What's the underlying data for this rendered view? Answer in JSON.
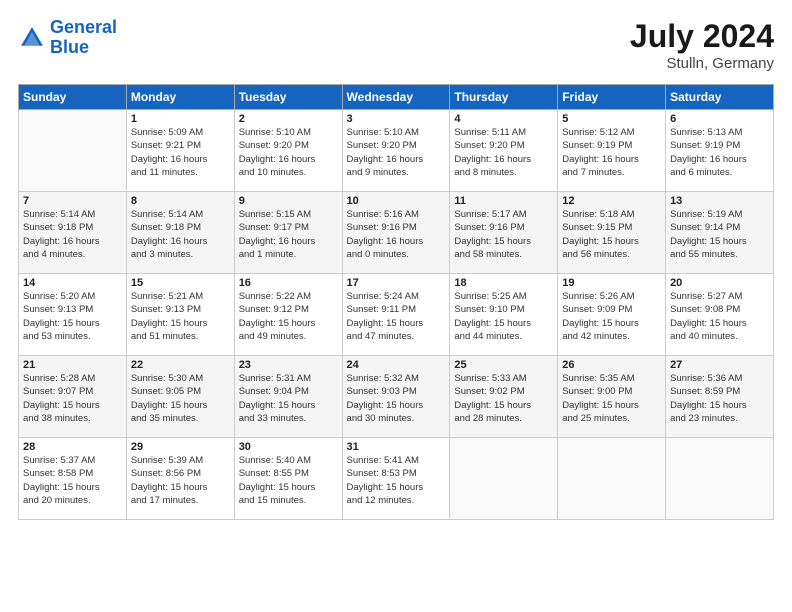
{
  "header": {
    "logo_line1": "General",
    "logo_line2": "Blue",
    "title": "July 2024",
    "location": "Stulln, Germany"
  },
  "columns": [
    "Sunday",
    "Monday",
    "Tuesday",
    "Wednesday",
    "Thursday",
    "Friday",
    "Saturday"
  ],
  "weeks": [
    [
      {
        "day": "",
        "info": ""
      },
      {
        "day": "1",
        "info": "Sunrise: 5:09 AM\nSunset: 9:21 PM\nDaylight: 16 hours\nand 11 minutes."
      },
      {
        "day": "2",
        "info": "Sunrise: 5:10 AM\nSunset: 9:20 PM\nDaylight: 16 hours\nand 10 minutes."
      },
      {
        "day": "3",
        "info": "Sunrise: 5:10 AM\nSunset: 9:20 PM\nDaylight: 16 hours\nand 9 minutes."
      },
      {
        "day": "4",
        "info": "Sunrise: 5:11 AM\nSunset: 9:20 PM\nDaylight: 16 hours\nand 8 minutes."
      },
      {
        "day": "5",
        "info": "Sunrise: 5:12 AM\nSunset: 9:19 PM\nDaylight: 16 hours\nand 7 minutes."
      },
      {
        "day": "6",
        "info": "Sunrise: 5:13 AM\nSunset: 9:19 PM\nDaylight: 16 hours\nand 6 minutes."
      }
    ],
    [
      {
        "day": "7",
        "info": "Sunrise: 5:14 AM\nSunset: 9:18 PM\nDaylight: 16 hours\nand 4 minutes."
      },
      {
        "day": "8",
        "info": "Sunrise: 5:14 AM\nSunset: 9:18 PM\nDaylight: 16 hours\nand 3 minutes."
      },
      {
        "day": "9",
        "info": "Sunrise: 5:15 AM\nSunset: 9:17 PM\nDaylight: 16 hours\nand 1 minute."
      },
      {
        "day": "10",
        "info": "Sunrise: 5:16 AM\nSunset: 9:16 PM\nDaylight: 16 hours\nand 0 minutes."
      },
      {
        "day": "11",
        "info": "Sunrise: 5:17 AM\nSunset: 9:16 PM\nDaylight: 15 hours\nand 58 minutes."
      },
      {
        "day": "12",
        "info": "Sunrise: 5:18 AM\nSunset: 9:15 PM\nDaylight: 15 hours\nand 56 minutes."
      },
      {
        "day": "13",
        "info": "Sunrise: 5:19 AM\nSunset: 9:14 PM\nDaylight: 15 hours\nand 55 minutes."
      }
    ],
    [
      {
        "day": "14",
        "info": "Sunrise: 5:20 AM\nSunset: 9:13 PM\nDaylight: 15 hours\nand 53 minutes."
      },
      {
        "day": "15",
        "info": "Sunrise: 5:21 AM\nSunset: 9:13 PM\nDaylight: 15 hours\nand 51 minutes."
      },
      {
        "day": "16",
        "info": "Sunrise: 5:22 AM\nSunset: 9:12 PM\nDaylight: 15 hours\nand 49 minutes."
      },
      {
        "day": "17",
        "info": "Sunrise: 5:24 AM\nSunset: 9:11 PM\nDaylight: 15 hours\nand 47 minutes."
      },
      {
        "day": "18",
        "info": "Sunrise: 5:25 AM\nSunset: 9:10 PM\nDaylight: 15 hours\nand 44 minutes."
      },
      {
        "day": "19",
        "info": "Sunrise: 5:26 AM\nSunset: 9:09 PM\nDaylight: 15 hours\nand 42 minutes."
      },
      {
        "day": "20",
        "info": "Sunrise: 5:27 AM\nSunset: 9:08 PM\nDaylight: 15 hours\nand 40 minutes."
      }
    ],
    [
      {
        "day": "21",
        "info": "Sunrise: 5:28 AM\nSunset: 9:07 PM\nDaylight: 15 hours\nand 38 minutes."
      },
      {
        "day": "22",
        "info": "Sunrise: 5:30 AM\nSunset: 9:05 PM\nDaylight: 15 hours\nand 35 minutes."
      },
      {
        "day": "23",
        "info": "Sunrise: 5:31 AM\nSunset: 9:04 PM\nDaylight: 15 hours\nand 33 minutes."
      },
      {
        "day": "24",
        "info": "Sunrise: 5:32 AM\nSunset: 9:03 PM\nDaylight: 15 hours\nand 30 minutes."
      },
      {
        "day": "25",
        "info": "Sunrise: 5:33 AM\nSunset: 9:02 PM\nDaylight: 15 hours\nand 28 minutes."
      },
      {
        "day": "26",
        "info": "Sunrise: 5:35 AM\nSunset: 9:00 PM\nDaylight: 15 hours\nand 25 minutes."
      },
      {
        "day": "27",
        "info": "Sunrise: 5:36 AM\nSunset: 8:59 PM\nDaylight: 15 hours\nand 23 minutes."
      }
    ],
    [
      {
        "day": "28",
        "info": "Sunrise: 5:37 AM\nSunset: 8:58 PM\nDaylight: 15 hours\nand 20 minutes."
      },
      {
        "day": "29",
        "info": "Sunrise: 5:39 AM\nSunset: 8:56 PM\nDaylight: 15 hours\nand 17 minutes."
      },
      {
        "day": "30",
        "info": "Sunrise: 5:40 AM\nSunset: 8:55 PM\nDaylight: 15 hours\nand 15 minutes."
      },
      {
        "day": "31",
        "info": "Sunrise: 5:41 AM\nSunset: 8:53 PM\nDaylight: 15 hours\nand 12 minutes."
      },
      {
        "day": "",
        "info": ""
      },
      {
        "day": "",
        "info": ""
      },
      {
        "day": "",
        "info": ""
      }
    ]
  ]
}
